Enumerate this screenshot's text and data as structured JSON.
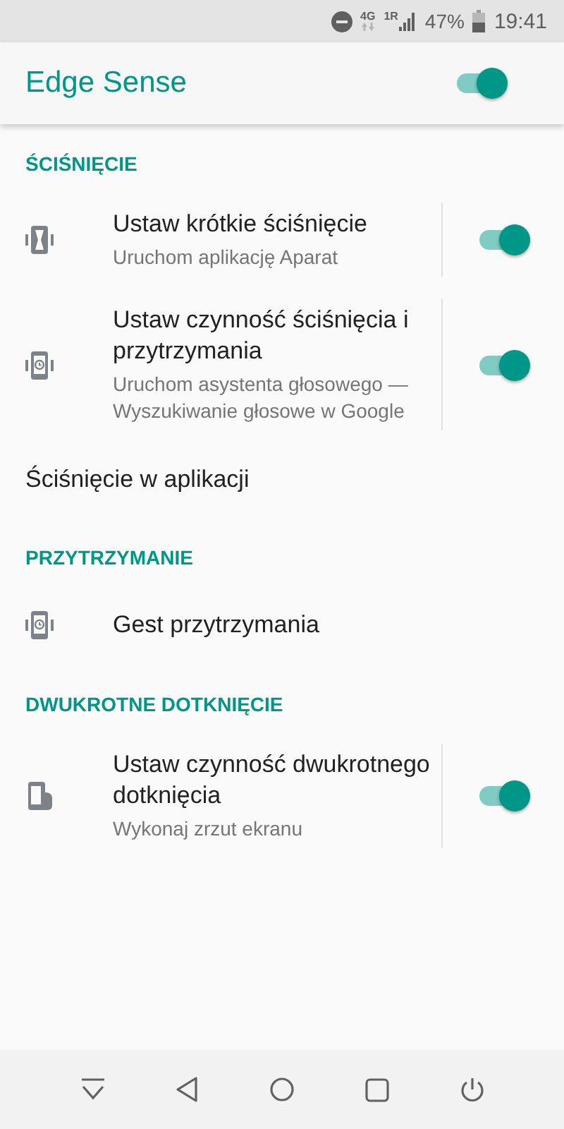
{
  "status_bar": {
    "network": "4G",
    "sim": "1R",
    "battery": "47%",
    "time": "19:41"
  },
  "app_bar": {
    "title": "Edge Sense",
    "on": true
  },
  "sections": [
    {
      "header": "ŚCIŚNIĘCIE",
      "items": [
        {
          "kind": "squeeze",
          "title": "Ustaw krótkie ściśnięcie",
          "summary": "Uruchom aplikację Aparat",
          "on": true
        },
        {
          "kind": "hold",
          "title": "Ustaw czynność ściśnięcia i przytrzymania",
          "summary": "Uruchom asystenta głosowego — Wyszukiwanie głosowe w Google",
          "on": true
        },
        {
          "kind": "plain",
          "title": "Ściśnięcie w aplikacji"
        }
      ]
    },
    {
      "header": "PRZYTRZYMANIE",
      "items": [
        {
          "kind": "hold",
          "title": "Gest przytrzymania"
        }
      ]
    },
    {
      "header": "DWUKROTNE DOTKNIĘCIE",
      "items": [
        {
          "kind": "tap",
          "title": "Ustaw czynność dwukrotnego dotknięcia",
          "summary": "Wykonaj zrzut ekranu",
          "on": true
        }
      ]
    }
  ]
}
